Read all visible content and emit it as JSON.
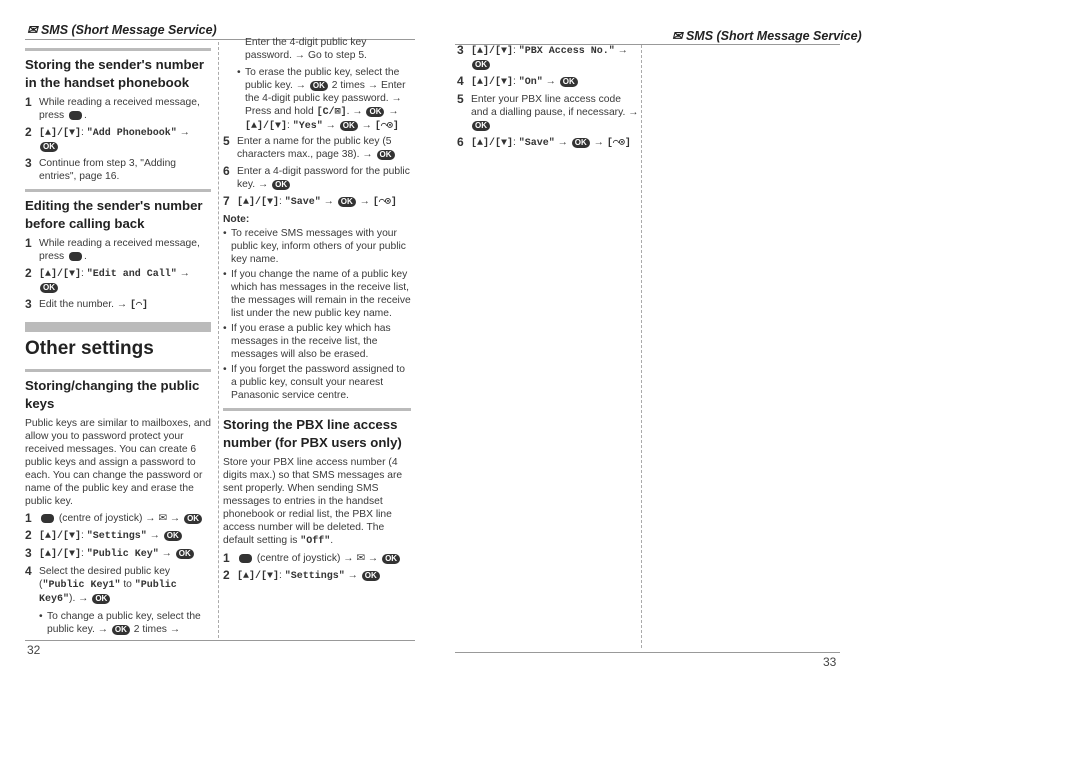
{
  "header_left": "✉ SMS (Short Message Service)",
  "header_right": "✉ SMS (Short Message Service)",
  "page_left": "32",
  "page_right": "33",
  "ok_label": "OK",
  "columns": [
    [
      {
        "type": "h2",
        "text": "Storing the sender's number in the handset phonebook"
      },
      {
        "type": "step",
        "num": "1",
        "segs": [
          "While reading a received message, press ",
          {
            "menu": 1
          },
          "."
        ]
      },
      {
        "type": "step",
        "num": "2",
        "segs": [
          {
            "k": "[▲]/[▼]"
          },
          ": ",
          {
            "m": "\"Add Phonebook\""
          },
          " → ",
          {
            "ok": 1
          }
        ]
      },
      {
        "type": "step",
        "num": "3",
        "segs": [
          "Continue from step 3, \"Adding entries\", page 16."
        ]
      },
      {
        "type": "h2",
        "text": "Editing the sender's number before calling back"
      },
      {
        "type": "step",
        "num": "1",
        "segs": [
          "While reading a received message, press ",
          {
            "menu": 1
          },
          "."
        ]
      },
      {
        "type": "step",
        "num": "2",
        "segs": [
          {
            "k": "[▲]/[▼]"
          },
          ": ",
          {
            "m": "\"Edit and Call\""
          },
          " → ",
          {
            "ok": 1
          }
        ]
      },
      {
        "type": "step",
        "num": "3",
        "segs": [
          "Edit the number. → ",
          {
            "k": "[⌒]"
          }
        ]
      },
      {
        "type": "h1",
        "text": "Other settings"
      },
      {
        "type": "h2",
        "text": "Storing/changing the public keys"
      },
      {
        "type": "para",
        "segs": [
          "Public keys are similar to mailboxes, and allow you to password protect your received messages. You can create 6 public keys and assign a password to each. You can change the password or name of the public key and erase the public key."
        ]
      },
      {
        "type": "step",
        "num": "1",
        "segs": [
          {
            "menu": 1
          },
          " (centre of joystick) → ✉ → ",
          {
            "ok": 1
          }
        ]
      },
      {
        "type": "step",
        "num": "2",
        "segs": [
          {
            "k": "[▲]/[▼]"
          },
          ": ",
          {
            "m": "\"Settings\""
          },
          " → ",
          {
            "ok": 1
          }
        ]
      },
      {
        "type": "step",
        "num": "3",
        "segs": [
          {
            "k": "[▲]/[▼]"
          },
          ": ",
          {
            "m": "\"Public Key\""
          },
          " → ",
          {
            "ok": 1
          }
        ]
      },
      {
        "type": "step",
        "num": "4",
        "segs": [
          "Select the desired public key (",
          {
            "m": "\"Public Key1\""
          },
          " to ",
          {
            "m": "\"Public Key6\""
          },
          "). → ",
          {
            "ok": 1
          }
        ]
      },
      {
        "type": "bullet",
        "segs": [
          "To change a public key, select the public key. → ",
          {
            "ok": 1
          },
          " 2 times →"
        ]
      }
    ],
    [
      {
        "type": "cont",
        "segs": [
          "Enter the 4-digit public key password. → Go to step 5."
        ]
      },
      {
        "type": "bullet",
        "segs": [
          "To erase the public key, select the public key. → ",
          {
            "ok": 1
          },
          " 2 times → Enter the 4-digit public key password. → Press and hold ",
          {
            "k": "[C/⊠]"
          },
          ". → ",
          {
            "ok": 1
          },
          " → ",
          {
            "k": "[▲]/[▼]"
          },
          ": ",
          {
            "m": "\"Yes\""
          },
          " → ",
          {
            "ok": 1
          },
          " → ",
          {
            "k": "[⌒⊙]"
          }
        ]
      },
      {
        "type": "step",
        "num": "5",
        "segs": [
          "Enter a name for the public key (5 characters max., page 38). → ",
          {
            "ok": 1
          }
        ]
      },
      {
        "type": "step",
        "num": "6",
        "segs": [
          "Enter a 4-digit password for the public key. → ",
          {
            "ok": 1
          }
        ]
      },
      {
        "type": "step",
        "num": "7",
        "segs": [
          {
            "k": "[▲]/[▼]"
          },
          ": ",
          {
            "m": "\"Save\""
          },
          " → ",
          {
            "ok": 1
          },
          " → ",
          {
            "k": "[⌒⊙]"
          }
        ]
      },
      {
        "type": "note",
        "text": "Note:"
      },
      {
        "type": "bullet0",
        "segs": [
          "To receive SMS messages with your public key, inform others of your public key name."
        ]
      },
      {
        "type": "bullet0",
        "segs": [
          "If you change the name of a public key which has messages in the receive list, the messages will remain in the receive list under the new public key name."
        ]
      },
      {
        "type": "bullet0",
        "segs": [
          "If you erase a public key which has messages in the receive list, the messages will also be erased."
        ]
      },
      {
        "type": "bullet0",
        "segs": [
          "If you forget the password assigned to a public key, consult your nearest Panasonic service centre."
        ]
      },
      {
        "type": "h2",
        "text": "Storing the PBX line access number (for PBX users only)"
      },
      {
        "type": "para",
        "segs": [
          "Store your PBX line access number (4 digits max.) so that SMS messages are sent properly. When sending SMS messages to entries in the handset phonebook or redial list, the PBX line access number will be deleted. The default setting is ",
          {
            "m": "\"Off\""
          },
          "."
        ]
      },
      {
        "type": "step",
        "num": "1",
        "segs": [
          {
            "menu": 1
          },
          " (centre of joystick) → ✉ → ",
          {
            "ok": 1
          }
        ]
      },
      {
        "type": "step",
        "num": "2",
        "segs": [
          {
            "k": "[▲]/[▼]"
          },
          ": ",
          {
            "m": "\"Settings\""
          },
          " → ",
          {
            "ok": 1
          }
        ]
      }
    ],
    [
      {
        "type": "step",
        "num": "3",
        "segs": [
          {
            "k": "[▲]/[▼]"
          },
          ": ",
          {
            "m": "\"PBX Access No.\""
          },
          " → ",
          {
            "ok": 1
          }
        ]
      },
      {
        "type": "step",
        "num": "4",
        "segs": [
          {
            "k": "[▲]/[▼]"
          },
          ": ",
          {
            "m": "\"On\""
          },
          " → ",
          {
            "ok": 1
          }
        ]
      },
      {
        "type": "step",
        "num": "5",
        "segs": [
          "Enter your PBX line access code and a dialling pause, if necessary. → ",
          {
            "ok": 1
          }
        ]
      },
      {
        "type": "step",
        "num": "6",
        "segs": [
          {
            "k": "[▲]/[▼]"
          },
          ": ",
          {
            "m": "\"Save\""
          },
          " → ",
          {
            "ok": 1
          },
          " → ",
          {
            "k": "[⌒⊙]"
          }
        ]
      }
    ]
  ]
}
